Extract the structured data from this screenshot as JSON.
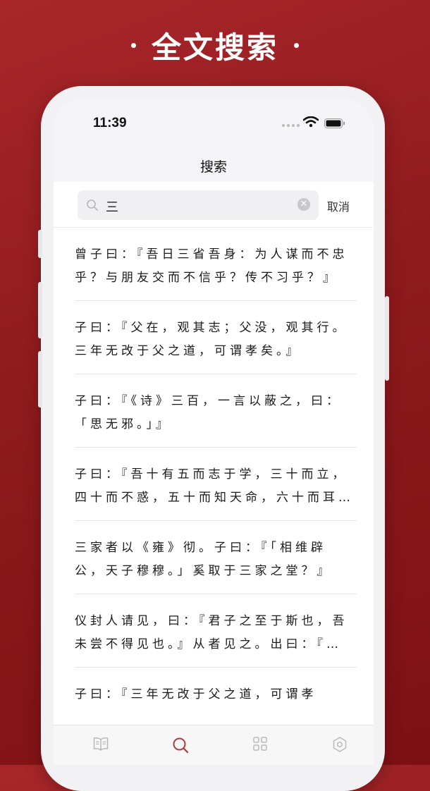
{
  "banner": {
    "title": "全文搜索"
  },
  "status_bar": {
    "time": "11:39"
  },
  "nav": {
    "title": "搜索"
  },
  "search": {
    "value": "三",
    "cancel_label": "取消"
  },
  "results": [
    {
      "line1": "曾子曰：『吾日三省吾身：为人谋而不忠",
      "line2": "乎？与朋友交而不信乎？传不习乎？』"
    },
    {
      "line1": "子曰：『父在，观其志；父没，观其行。",
      "line2": "三年无改于父之道，可谓孝矣。』"
    },
    {
      "line1": "子曰：『《诗》三百，一言以蔽之，曰：",
      "line2": "「思无邪。」』"
    },
    {
      "line1": "子曰：『吾十有五而志于学，三十而立，",
      "line2": "四十而不惑，五十而知天命，六十而耳…"
    },
    {
      "line1": "三家者以《雍》彻。子曰：『「相维辟",
      "line2": "公，天子穆穆。」奚取于三家之堂？』"
    },
    {
      "line1": "仪封人请见，曰：『君子之至于斯也，吾",
      "line2": "未尝不得见也。』从者见之。出曰：『…"
    },
    {
      "line1": "子曰：『三年无改于父之道，可谓孝",
      "line2": ""
    }
  ],
  "tabbar": {
    "items": [
      {
        "icon": "book-icon",
        "active": false
      },
      {
        "icon": "search-icon",
        "active": true
      },
      {
        "icon": "grid-icon",
        "active": false
      },
      {
        "icon": "settings-icon",
        "active": false
      }
    ],
    "active_color": "#b0393c",
    "inactive_color": "#b8b8bc"
  },
  "colors": {
    "background": "#8e1a1d",
    "accent": "#b0393c"
  }
}
